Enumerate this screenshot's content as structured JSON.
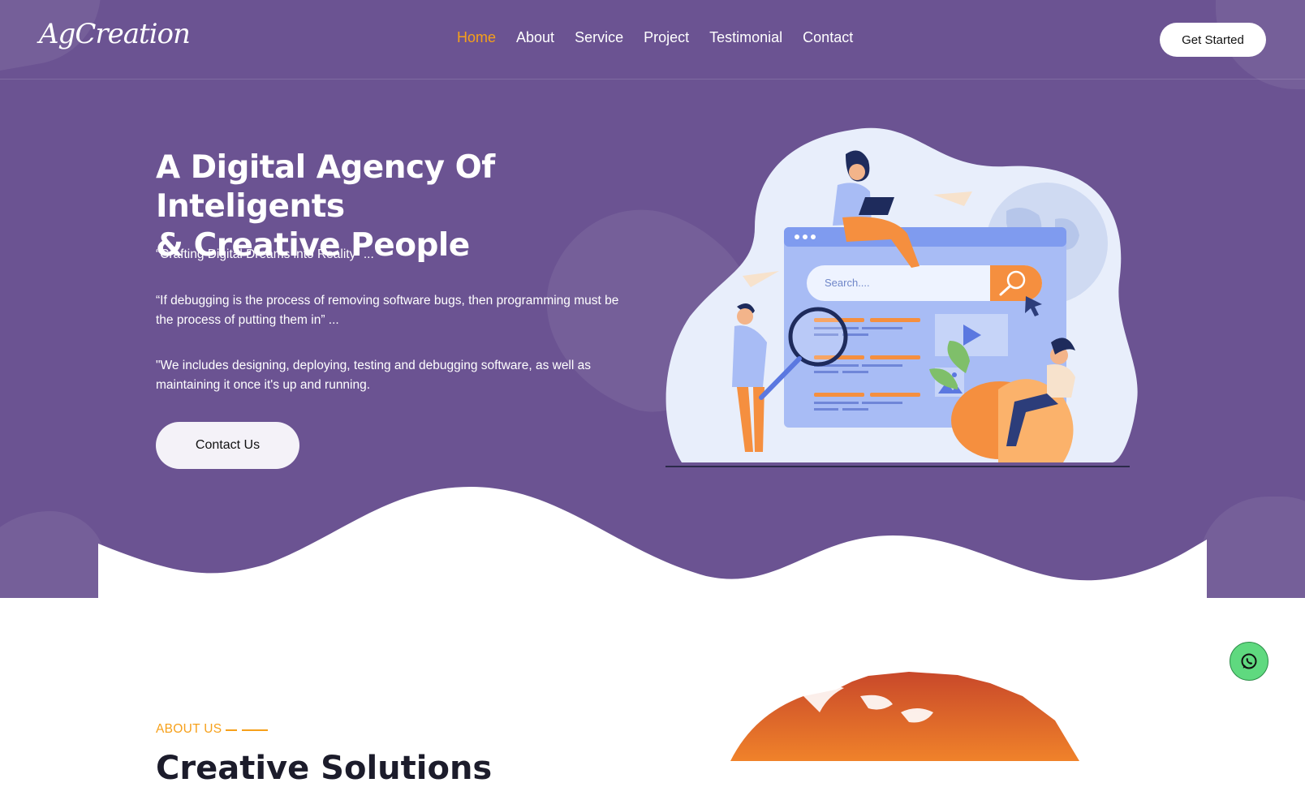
{
  "brand": {
    "logo": "AgCreation"
  },
  "nav": {
    "items": [
      {
        "label": "Home",
        "active": true
      },
      {
        "label": "About"
      },
      {
        "label": "Service"
      },
      {
        "label": "Project"
      },
      {
        "label": "Testimonial"
      },
      {
        "label": "Contact"
      }
    ],
    "cta_label": "Get Started"
  },
  "hero": {
    "title_line1": "A Digital Agency Of Inteligents",
    "title_line2": "& Creative People",
    "quotes": [
      "“Crafting Digital Dreams into Reality” ...",
      "“If debugging is the process of removing software bugs, then programming must be the process of putting them in” ...",
      "\"We includes designing, deploying, testing and debugging software, as well as maintaining it once it's up and running."
    ],
    "button_label": "Contact Us",
    "illustration": {
      "search_placeholder": "Search...."
    }
  },
  "about": {
    "label": "ABOUT US",
    "heading": "Creative Solutions"
  },
  "colors": {
    "hero_bg": "#6b5392",
    "accent": "#f6a01a",
    "whatsapp": "#5fd97f"
  },
  "icons": [
    "whatsapp-icon",
    "search-icon",
    "play-icon",
    "image-icon",
    "cursor-icon"
  ]
}
